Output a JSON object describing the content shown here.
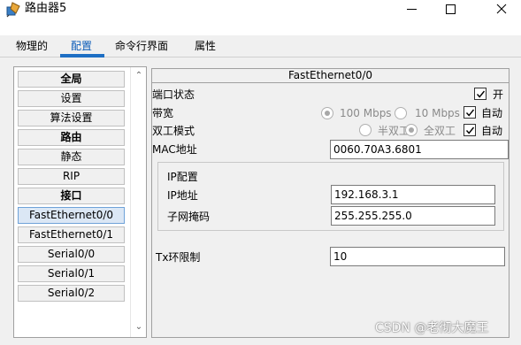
{
  "window": {
    "title": "路由器5",
    "icon": "router-icon"
  },
  "tabs": [
    "物理的",
    "配置",
    "命令行界面",
    "属性"
  ],
  "active_tab": "配置",
  "sidebar": {
    "items": [
      {
        "label": "全局",
        "header": true
      },
      {
        "label": "设置",
        "header": false
      },
      {
        "label": "算法设置",
        "header": false
      },
      {
        "label": "路由",
        "header": true
      },
      {
        "label": "静态",
        "header": false
      },
      {
        "label": "RIP",
        "header": false
      },
      {
        "label": "接口",
        "header": true
      },
      {
        "label": "FastEthernet0/0",
        "header": false,
        "selected": true
      },
      {
        "label": "FastEthernet0/1",
        "header": false
      },
      {
        "label": "Serial0/0",
        "header": false
      },
      {
        "label": "Serial0/1",
        "header": false
      },
      {
        "label": "Serial0/2",
        "header": false
      }
    ]
  },
  "panel": {
    "title": "FastEthernet0/0",
    "port_status": {
      "label": "端口状态",
      "checkbox_label": "开",
      "checked": true
    },
    "bandwidth": {
      "label": "带宽",
      "opt100": "100 Mbps",
      "opt10": "10 Mbps",
      "auto_label": "自动",
      "auto_checked": true
    },
    "duplex": {
      "label": "双工模式",
      "half": "半双工",
      "full": "全双工",
      "auto_label": "自动",
      "auto_checked": true
    },
    "mac": {
      "label": "MAC地址",
      "value": "0060.70A3.6801"
    },
    "ip_group": {
      "title": "IP配置",
      "ip_label": "IP地址",
      "ip_value": "192.168.3.1",
      "mask_label": "子网掩码",
      "mask_value": "255.255.255.0"
    },
    "tx": {
      "label": "Tx环限制",
      "value": "10"
    }
  },
  "watermark": "CSDN @老彻大魔王",
  "colors": {
    "accent": "#1e6fc4",
    "selected_bg": "#dbe7f5",
    "panel_bg": "#f0f0f0"
  }
}
